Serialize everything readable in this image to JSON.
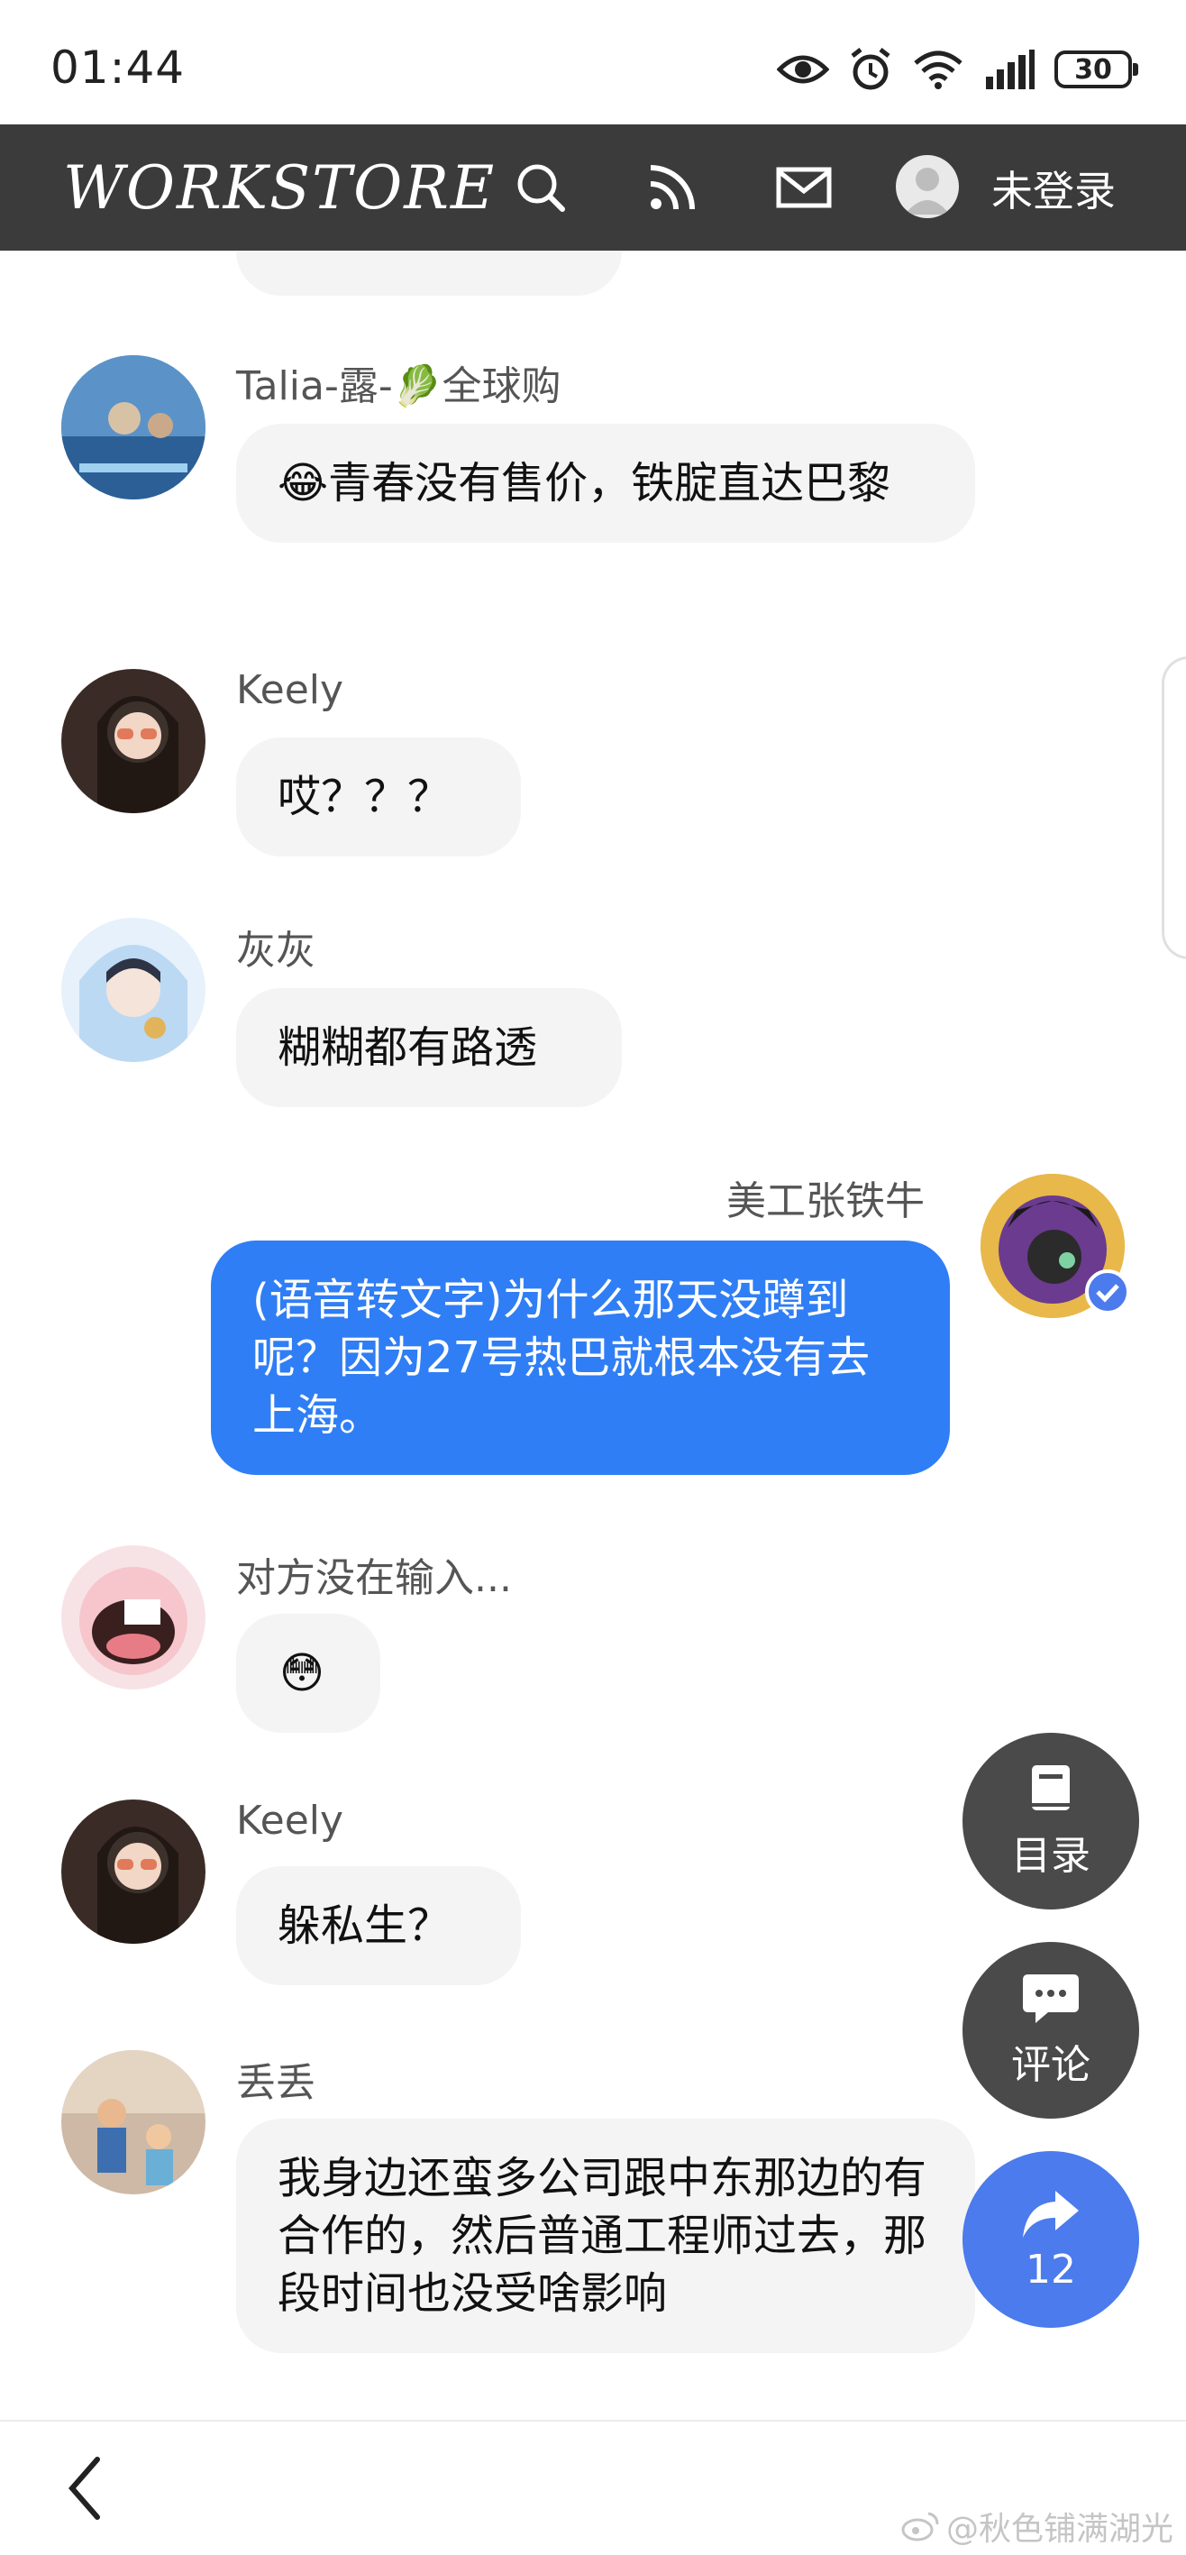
{
  "status_bar": {
    "time": "01:44",
    "battery": "30"
  },
  "header": {
    "logo": "WORKSTORE",
    "login_label": "未登录"
  },
  "messages": [
    {
      "name": "Talia-露-🥬全球购",
      "text": "😂青春没有售价，铁腚直达巴黎"
    },
    {
      "name": "Keely",
      "text": "哎？？？"
    },
    {
      "name": "灰灰",
      "text": "糊糊都有路透"
    },
    {
      "name": "美工张铁牛",
      "text": "(语音转文字)为什么那天没蹲到呢？因为27号热巴就根本没有去上海。"
    },
    {
      "name": "对方没在输入...",
      "text": "😳"
    },
    {
      "name": "Keely",
      "text": "躲私生？"
    },
    {
      "name": "丢丢",
      "text": "我身边还蛮多公司跟中东那边的有合作的，然后普通工程师过去，那段时间也没受啥影响"
    }
  ],
  "fabs": {
    "toc_label": "目录",
    "comment_label": "评论",
    "share_count": "12"
  },
  "watermark": "@秋色铺满湖光",
  "colors": {
    "header_bg": "#3b3b3b",
    "my_bubble": "#2f7ef5",
    "share_fab": "#4b7bec",
    "fab_bg": "#4a4a4a"
  }
}
